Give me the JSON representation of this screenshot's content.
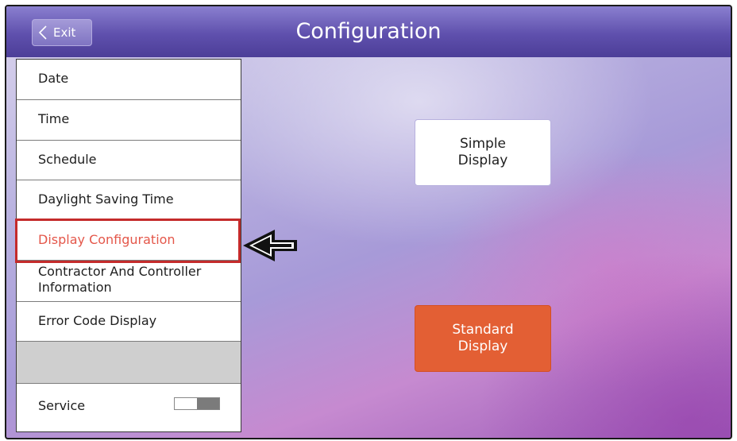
{
  "header": {
    "exit_label": "Exit",
    "title": "Configuration"
  },
  "menu": {
    "items": [
      {
        "label": "Date"
      },
      {
        "label": "Time"
      },
      {
        "label": "Schedule"
      },
      {
        "label": "Daylight Saving Time"
      },
      {
        "label": "Display Configuration",
        "selected": true
      },
      {
        "label_line1": "Contractor And Controller",
        "label_line2": "Information"
      },
      {
        "label": "Error Code Display"
      },
      {
        "label": "Service",
        "toggle_on": false
      }
    ]
  },
  "options": {
    "simple_line1": "Simple",
    "simple_line2": "Display",
    "standard_line1": "Standard",
    "standard_line2": "Display"
  },
  "colors": {
    "header": "#5f50ad",
    "selected_text": "#e4574a",
    "highlight_box": "#c42b2b",
    "standard_button": "#e35f34"
  },
  "icons": {
    "exit": "chevron-left-icon",
    "pointer": "arrow-left-icon"
  }
}
